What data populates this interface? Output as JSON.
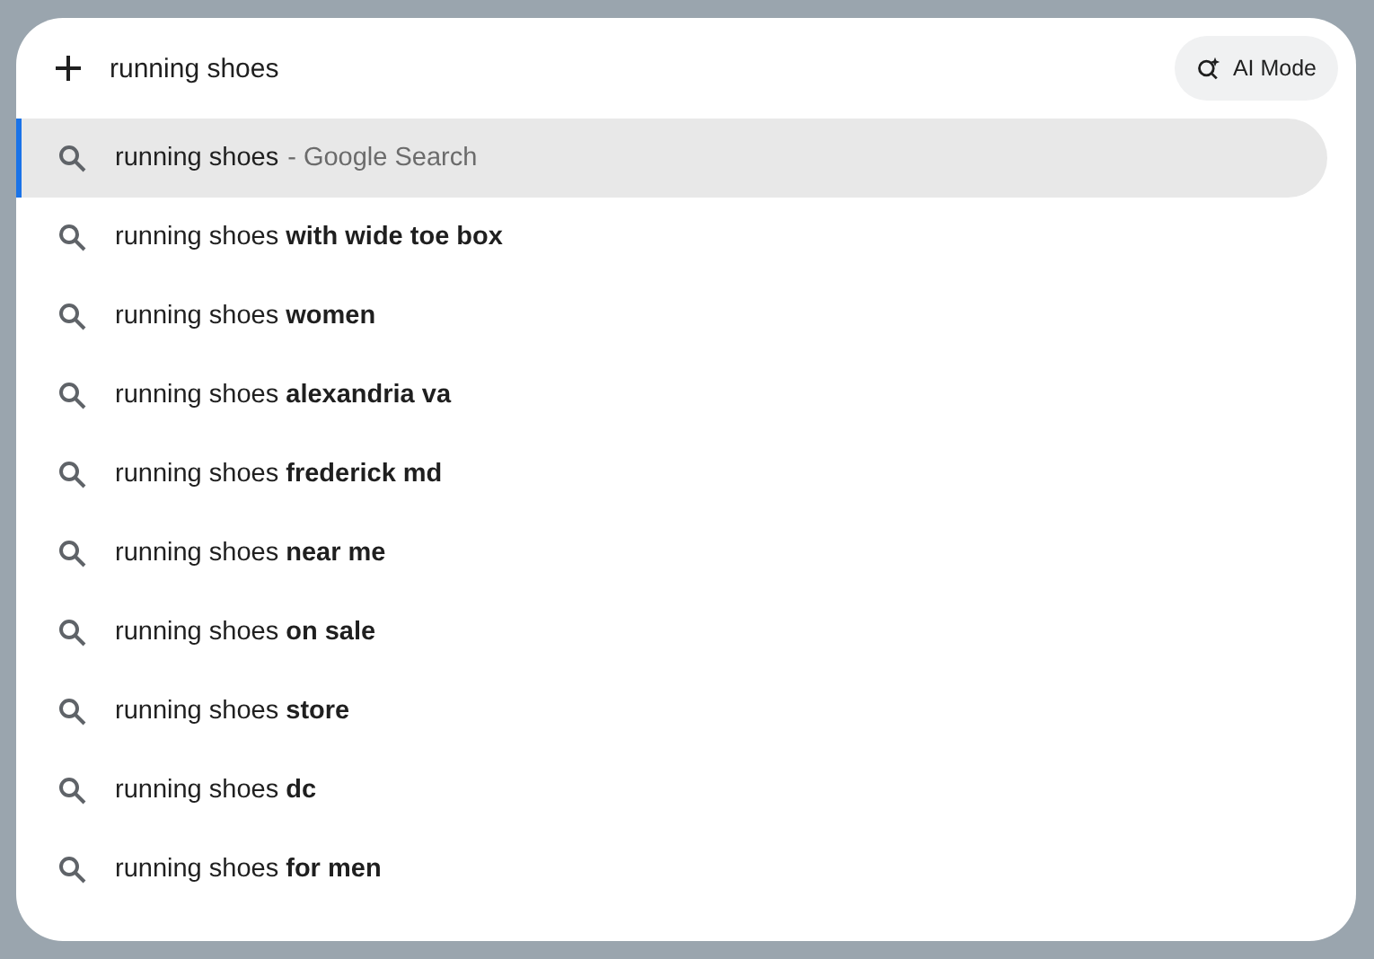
{
  "search": {
    "value": "running shoes",
    "ai_button": "AI Mode"
  },
  "suggestions": [
    {
      "text": "running shoes",
      "hint": "- Google Search",
      "selected": true
    },
    {
      "text": "running shoes **with wide toe box**",
      "selected": false
    },
    {
      "text": "running shoes **women**",
      "selected": false
    },
    {
      "text": "running shoes **alexandria va**",
      "selected": false
    },
    {
      "text": "running shoes **frederick md**",
      "selected": false
    },
    {
      "text": "running shoes **near me**",
      "selected": false
    },
    {
      "text": "running shoes **on sale**",
      "selected": false
    },
    {
      "text": "running shoes **store**",
      "selected": false
    },
    {
      "text": "running shoes **dc**",
      "selected": false
    },
    {
      "text": "running shoes **for men**",
      "selected": false
    }
  ]
}
